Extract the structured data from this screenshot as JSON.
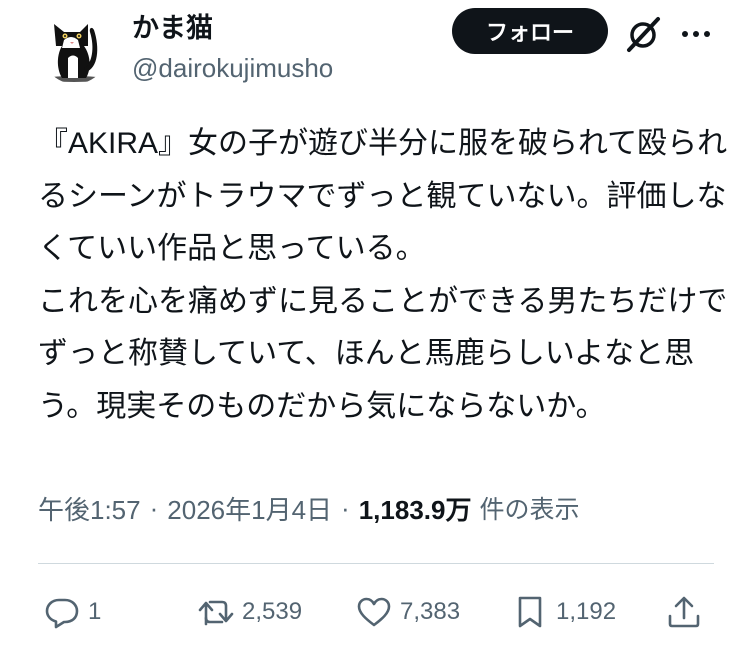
{
  "user": {
    "display_name": "かま猫",
    "handle": "@dairokujimusho",
    "avatar_icon": "cat-avatar"
  },
  "header": {
    "follow_label": "フォロー",
    "grok_icon": "grok-icon",
    "more_icon": "more-icon"
  },
  "tweet": {
    "text": "『AKIRA』女の子が遊び半分に服を破られて殴られるシーンがトラウマでずっと観ていない。評価しなくていい作品と思っている。\nこれを心を痛めずに見ることができる男たちだけでずっと称賛していて、ほんと馬鹿らしいよなと思う。現実そのものだから気にならないか。"
  },
  "meta": {
    "time": "午後1:57",
    "separator": "·",
    "date": "2026年1月4日",
    "views_count": "1,183.9万",
    "views_label": "件の表示"
  },
  "actions": {
    "reply_count": "1",
    "retweet_count": "2,539",
    "like_count": "7,383",
    "bookmark_count": "1,192"
  },
  "colors": {
    "text": "#0f1419",
    "secondary": "#536471",
    "divider": "#cfd9de",
    "follow_bg": "#0f1419"
  }
}
